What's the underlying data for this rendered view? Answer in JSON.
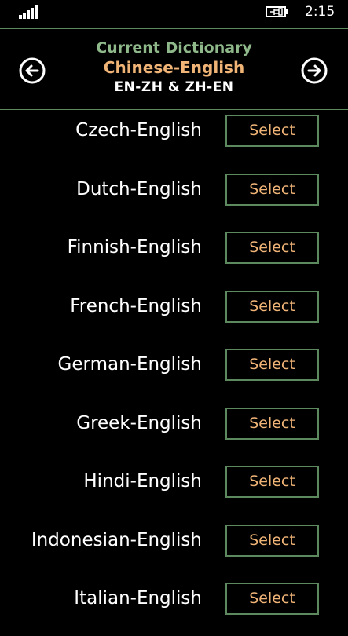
{
  "status_bar": {
    "time": "2:15",
    "signal_icon": "signal-strength-icon",
    "battery_icon": "battery-charging-icon"
  },
  "header": {
    "title": "Current Dictionary",
    "dictionary": "Chinese-English",
    "codes": "EN-ZH & ZH-EN",
    "prev_icon": "arrow-left-circle-icon",
    "next_icon": "arrow-right-circle-icon"
  },
  "colors": {
    "accent_green": "#8fb88b",
    "accent_orange": "#f0b477",
    "border_green": "#5c8a5e",
    "background": "#000000"
  },
  "dictionaries": [
    {
      "label": "Czech-English",
      "button": "Select"
    },
    {
      "label": "Dutch-English",
      "button": "Select"
    },
    {
      "label": "Finnish-English",
      "button": "Select"
    },
    {
      "label": "French-English",
      "button": "Select"
    },
    {
      "label": "German-English",
      "button": "Select"
    },
    {
      "label": "Greek-English",
      "button": "Select"
    },
    {
      "label": "Hindi-English",
      "button": "Select"
    },
    {
      "label": "Indonesian-English",
      "button": "Select"
    },
    {
      "label": "Italian-English",
      "button": "Select"
    }
  ]
}
